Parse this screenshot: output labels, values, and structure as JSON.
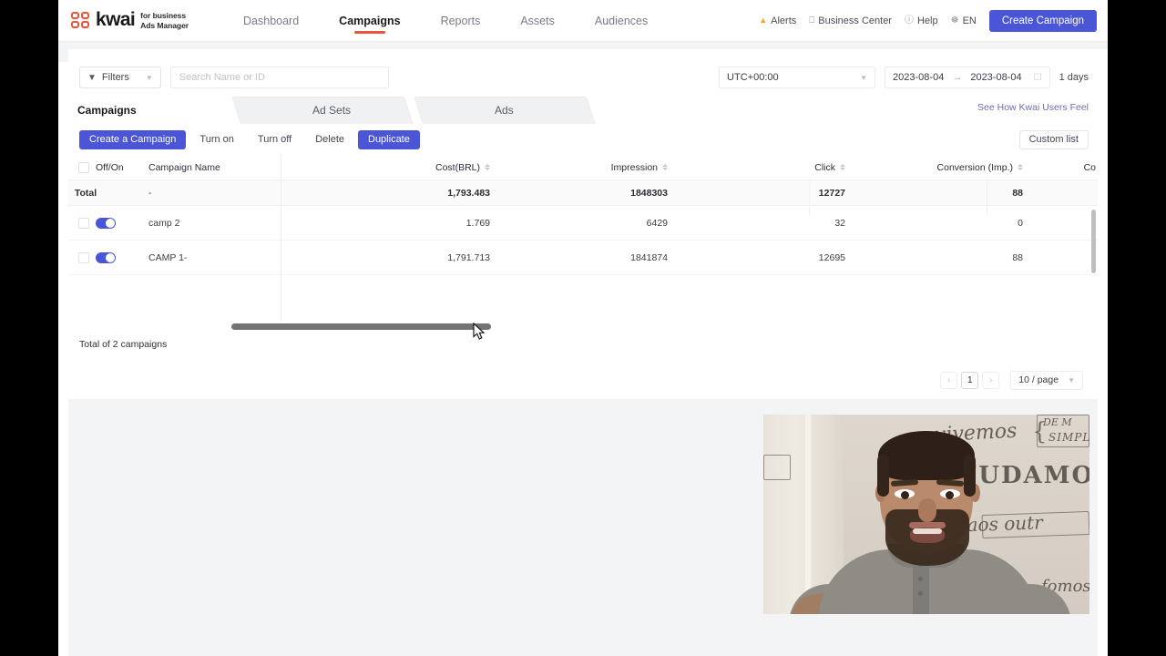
{
  "header": {
    "brand_word": "kwai",
    "brand_sub_line1": "for business",
    "brand_sub_line2": "Ads Manager",
    "nav": [
      {
        "label": "Dashboard",
        "active": false
      },
      {
        "label": "Campaigns",
        "active": true
      },
      {
        "label": "Reports",
        "active": false
      },
      {
        "label": "Assets",
        "active": false
      },
      {
        "label": "Audiences",
        "active": false
      }
    ],
    "alerts": "Alerts",
    "business_center": "Business Center",
    "help": "Help",
    "language": "EN",
    "create_campaign": "Create Campaign"
  },
  "filterbar": {
    "filters_label": "Filters",
    "search_placeholder": "Search Name or ID",
    "search_value": "",
    "timezone": "UTC+00:00",
    "date_start": "2023-08-04",
    "date_end": "2023-08-04",
    "date_separator": "→",
    "days_label": "1 days"
  },
  "tabs": {
    "items": [
      {
        "label": "Campaigns",
        "active": true
      },
      {
        "label": "Ad Sets",
        "active": false
      },
      {
        "label": "Ads",
        "active": false
      }
    ],
    "see_link": "See How Kwai Users Feel"
  },
  "actions": {
    "create_a_campaign": "Create a Campaign",
    "turn_on": "Turn on",
    "turn_off": "Turn off",
    "delete": "Delete",
    "duplicate": "Duplicate",
    "custom_list": "Custom list"
  },
  "table": {
    "columns": [
      "Off/On",
      "Campaign Name",
      "Cost(BRL)",
      "Impression",
      "Click",
      "Conversion (Imp.)",
      "Co"
    ],
    "total_label": "Total",
    "total_row": {
      "name": "-",
      "cost": "1,793.483",
      "impression": "1848303",
      "click": "12727",
      "conversion": "88"
    },
    "rows": [
      {
        "name": "camp 2",
        "enabled": true,
        "cost": "1.769",
        "impression": "6429",
        "click": "32",
        "conversion": "0"
      },
      {
        "name": "CAMP 1-",
        "enabled": true,
        "cost": "1,791.713",
        "impression": "1841874",
        "click": "12695",
        "conversion": "88"
      }
    ],
    "footer_count": "Total of 2 campaigns"
  },
  "pagination": {
    "prev": "‹",
    "page": "1",
    "next": "›",
    "page_size": "10 / page"
  },
  "video": {
    "wall_text_1": "vivemos",
    "wall_text_2": "DE M",
    "wall_text_3": "SIMPL",
    "wall_text_4": "JUDAMOS",
    "wall_text_5": "s aos outr",
    "wall_text_6": "fomos"
  },
  "colors": {
    "brand_orange": "#e8563a",
    "accent_blue": "#4a56d6",
    "page_grey": "#f3f4f6"
  }
}
